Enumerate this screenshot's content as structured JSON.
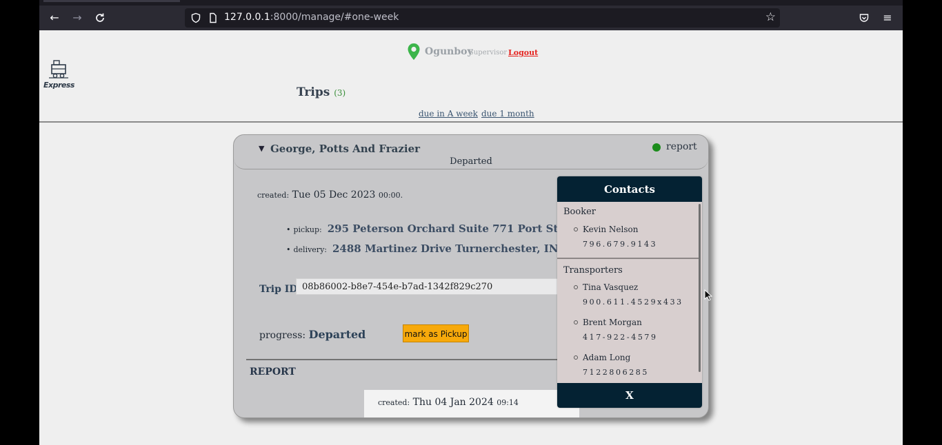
{
  "browser": {
    "url_host": "127.0.0.1",
    "url_rest": ":8000/manage/#one-week",
    "icons": [
      "back-arrow-icon",
      "forward-arrow-icon",
      "reload-icon",
      "shield-icon",
      "page-icon",
      "star-icon",
      "pocket-icon",
      "menu-icon"
    ]
  },
  "header": {
    "logo_text": "Express",
    "username": "Ogunboy",
    "role": "Supervisor",
    "logout": "Logout",
    "trips_label": "Trips",
    "trips_count": "(3)",
    "filters": [
      "due in A week",
      "due 1 month"
    ]
  },
  "trip": {
    "company": "George, Potts And Frazier",
    "status": "Departed",
    "report_link": "report",
    "status_dot_color": "#1b8c1b",
    "created_label": "created:",
    "created_date": "Tue 05 Dec 2023",
    "created_time": "00:00.",
    "pickup_label": "pickup:",
    "pickup_address": "295 Peterson Orchard Suite 771 Port Stefanieside, DC",
    "delivery_label": "delivery:",
    "delivery_address": "2488 Martinez Drive Turnerchester, IN 79497",
    "trip_id_label": "Trip ID:",
    "trip_id": "08b86002-b8e7-454e-b7ad-1342f829c270",
    "progress_label": "progress:",
    "progress_value": "Departed",
    "mark_button": "mark as Pickup",
    "report_heading": "REPORT",
    "report_created_label": "created:",
    "report_created_date": "Thu 04 Jan 2024",
    "report_created_time": "09:14"
  },
  "contacts": {
    "title": "Contacts",
    "booker_title": "Booker",
    "booker": {
      "name": "Kevin Nelson",
      "phone": "796.679.9143"
    },
    "transporters_title": "Transporters",
    "transporters": [
      {
        "name": "Tina Vasquez",
        "phone": "900.611.4529x433"
      },
      {
        "name": "Brent Morgan",
        "phone": "417-922-4579"
      },
      {
        "name": "Adam Long",
        "phone": "7122806285"
      }
    ],
    "close": "X"
  },
  "colors": {
    "accent_orange": "#f7a90b",
    "contacts_header": "#042233",
    "logout_red": "#e5221e"
  }
}
